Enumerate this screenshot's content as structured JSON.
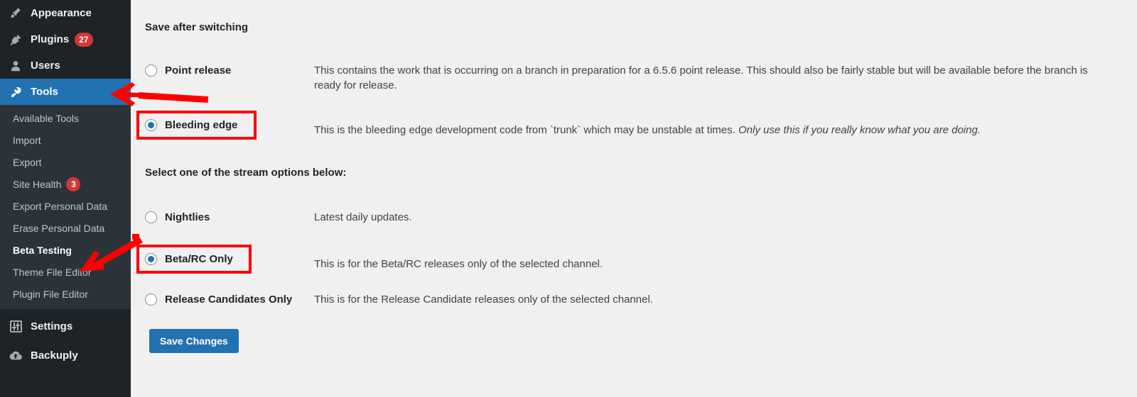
{
  "sidebar": {
    "top_items": [
      {
        "label": "Appearance",
        "icon": "paintbrush-icon",
        "badge": null,
        "active": false
      },
      {
        "label": "Plugins",
        "icon": "plug-icon",
        "badge": "27",
        "active": false
      },
      {
        "label": "Users",
        "icon": "user-icon",
        "badge": null,
        "active": false
      },
      {
        "label": "Tools",
        "icon": "wrench-icon",
        "badge": null,
        "active": true
      }
    ],
    "submenu_items": [
      {
        "label": "Available Tools",
        "badge": null,
        "current": false
      },
      {
        "label": "Import",
        "badge": null,
        "current": false
      },
      {
        "label": "Export",
        "badge": null,
        "current": false
      },
      {
        "label": "Site Health",
        "badge": "3",
        "current": false
      },
      {
        "label": "Export Personal Data",
        "badge": null,
        "current": false
      },
      {
        "label": "Erase Personal Data",
        "badge": null,
        "current": false
      },
      {
        "label": "Beta Testing",
        "badge": null,
        "current": true
      },
      {
        "label": "Theme File Editor",
        "badge": null,
        "current": false
      },
      {
        "label": "Plugin File Editor",
        "badge": null,
        "current": false
      }
    ],
    "bottom_items": [
      {
        "label": "Settings",
        "icon": "settings-sliders-icon",
        "badge": null,
        "active": false
      },
      {
        "label": "Backuply",
        "icon": "cloud-upload-icon",
        "badge": null,
        "active": false
      }
    ]
  },
  "main": {
    "save_after_switching_title": "Save after switching",
    "channel_options": [
      {
        "label": "Point release",
        "checked": false,
        "highlighted": false,
        "desc_plain": "This contains the work that is occurring on a branch in preparation for a 6.5.6 point release. This should also be fairly stable but will be available before the branch is ready for release.",
        "desc_italic": ""
      },
      {
        "label": "Bleeding edge",
        "checked": true,
        "highlighted": true,
        "desc_plain": "This is the bleeding edge development code from `trunk` which may be unstable at times. ",
        "desc_italic": "Only use this if you really know what you are doing."
      }
    ],
    "stream_title": "Select one of the stream options below:",
    "stream_options": [
      {
        "label": "Nightlies",
        "checked": false,
        "highlighted": false,
        "desc_plain": "Latest daily updates.",
        "desc_italic": ""
      },
      {
        "label": "Beta/RC Only",
        "checked": true,
        "highlighted": true,
        "desc_plain": "This is for the Beta/RC releases only of the selected channel.",
        "desc_italic": ""
      },
      {
        "label": "Release Candidates Only",
        "checked": false,
        "highlighted": false,
        "desc_plain": "This is for the Release Candidate releases only of the selected channel.",
        "desc_italic": ""
      }
    ],
    "save_button_label": "Save Changes"
  },
  "annotations": {
    "arrow_color": "#ff0000",
    "highlight_box_color": "#ff0000",
    "arrow_to_tools": "points left toward Tools menu item",
    "arrow_to_beta_testing": "points down-left toward Beta Testing submenu item"
  },
  "colors": {
    "sidebar_bg": "#1d2327",
    "submenu_bg": "#2c3338",
    "accent_blue": "#2271b1",
    "badge_red": "#d63638",
    "content_bg": "#f0f0f1",
    "annotation_red": "#ff0000"
  }
}
